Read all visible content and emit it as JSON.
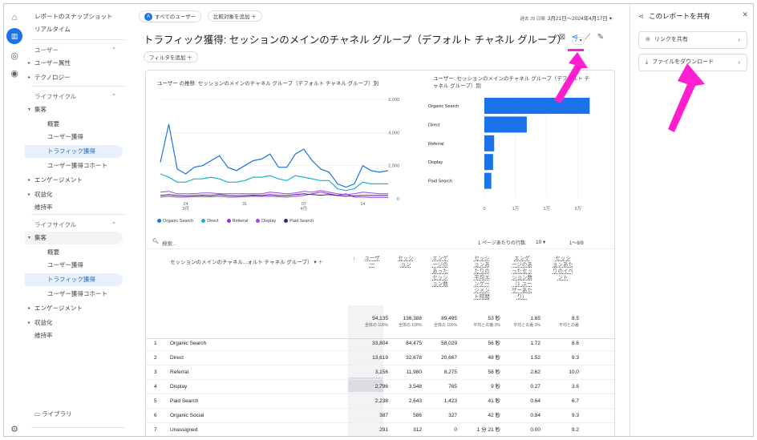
{
  "nav": {
    "items": [
      {
        "label": "レポートのスナップショット",
        "type": "top"
      },
      {
        "label": "リアルタイム",
        "type": "top"
      },
      {
        "label": "ユーザー",
        "type": "head"
      },
      {
        "label": "ユーザー属性",
        "type": "collapsed"
      },
      {
        "label": "テクノロジー",
        "type": "collapsed"
      },
      {
        "label": "ライフサイクル",
        "type": "head"
      },
      {
        "label": "集客",
        "type": "expanded"
      },
      {
        "label": "概要",
        "type": "sub"
      },
      {
        "label": "ユーザー獲得",
        "type": "sub"
      },
      {
        "label": "トラフィック獲得",
        "type": "sub-active"
      },
      {
        "label": "ユーザー獲得コホート",
        "type": "sub"
      },
      {
        "label": "エンゲージメント",
        "type": "collapsed"
      },
      {
        "label": "収益化",
        "type": "collapsed"
      },
      {
        "label": "維持率",
        "type": "plain"
      },
      {
        "label": "ライフサイクル",
        "type": "head"
      },
      {
        "label": "集客",
        "type": "expanded-grey"
      },
      {
        "label": "概要",
        "type": "sub"
      },
      {
        "label": "ユーザー獲得",
        "type": "sub"
      },
      {
        "label": "トラフィック獲得",
        "type": "sub-active"
      },
      {
        "label": "ユーザー獲得コホート",
        "type": "sub"
      },
      {
        "label": "エンゲージメント",
        "type": "collapsed"
      },
      {
        "label": "収益化",
        "type": "collapsed"
      },
      {
        "label": "維持率",
        "type": "plain"
      }
    ],
    "library": "ライブラリ"
  },
  "top": {
    "all_users": "すべてのユーザー",
    "add_comparison": "比較対象を追加",
    "date_prefix": "過去 28 日間",
    "date_range": "3月21日～2024年4月17日"
  },
  "report": {
    "title": "トラフィック獲得: セッションのメインのチャネル グループ（デフォルト チャネル グループ）",
    "add_filter": "フィルタを追加"
  },
  "line_chart": {
    "title": "ユーザー の推移: セッションのメインのチャネル グループ（デフォルト チャネル グループ）別",
    "y_ticks": [
      "6,000",
      "4,000",
      "2,000",
      "0"
    ],
    "x_ticks": [
      "24\n3月",
      "31",
      "07\n4月",
      "14"
    ],
    "legend": [
      "Organic Search",
      "Direct",
      "Referral",
      "Display",
      "Paid Search"
    ]
  },
  "bar_chart": {
    "title": "ユーザー: セッションのメインのチャネル グループ（デフォルト チャネル グループ）別",
    "x_ticks": [
      "0",
      "1万",
      "2万",
      "3万"
    ]
  },
  "chart_data": [
    {
      "type": "line",
      "title": "ユーザー の推移: セッションのメインのチャネル グループ（デフォルト チャネル グループ）別",
      "ylim": [
        0,
        6000
      ],
      "x": [
        1,
        2,
        3,
        4,
        5,
        6,
        7,
        8,
        9,
        10,
        11,
        12,
        13,
        14,
        15,
        16,
        17,
        18,
        19,
        20,
        21,
        22,
        23,
        24,
        25,
        26,
        27,
        28
      ],
      "series": [
        {
          "name": "Organic Search",
          "color": "#1a73e8",
          "values": [
            2200,
            4500,
            1800,
            1500,
            1900,
            2000,
            2300,
            2600,
            1900,
            1700,
            2000,
            2300,
            2400,
            2700,
            1900,
            1900,
            2700,
            3000,
            2300,
            1800,
            1600,
            900,
            700,
            900,
            2000,
            1700,
            1600,
            1700
          ]
        },
        {
          "name": "Direct",
          "color": "#12b5cb",
          "values": [
            1500,
            1300,
            1000,
            1000,
            1200,
            1200,
            1300,
            1200,
            1000,
            1000,
            1100,
            1300,
            1300,
            1400,
            1200,
            1100,
            1400,
            1300,
            1200,
            1100,
            1100,
            600,
            500,
            600,
            1000,
            900,
            900,
            900
          ]
        },
        {
          "name": "Referral",
          "color": "#9334e6",
          "values": [
            100,
            150,
            100,
            100,
            120,
            130,
            120,
            150,
            100,
            100,
            120,
            150,
            140,
            160,
            120,
            100,
            150,
            200,
            300,
            400,
            300,
            200,
            300,
            100,
            100,
            80,
            80,
            80
          ]
        },
        {
          "name": "Display",
          "color": "#a142f4",
          "values": [
            400,
            450,
            300,
            300,
            300,
            350,
            350,
            300,
            300,
            300,
            300,
            300,
            300,
            400,
            350,
            300,
            350,
            450,
            400,
            500,
            400,
            300,
            250,
            300,
            400,
            350,
            300,
            300
          ]
        },
        {
          "name": "Paid Search",
          "color": "#4a148c",
          "values": [
            200,
            250,
            200,
            180,
            200,
            220,
            200,
            250,
            200,
            180,
            200,
            220,
            200,
            250,
            200,
            200,
            250,
            300,
            250,
            220,
            250,
            200,
            150,
            180,
            200,
            200,
            200,
            200
          ]
        }
      ]
    },
    {
      "type": "bar",
      "title": "ユーザー: セッションのメインのチャネル グループ（デフォルト チャネル グループ）別",
      "categories": [
        "Organic Search",
        "Direct",
        "Referral",
        "Display",
        "Paid Search"
      ],
      "values": [
        33804,
        13619,
        3156,
        2796,
        2238
      ],
      "xlim": [
        0,
        35000
      ],
      "color": "#1a73e8"
    }
  ],
  "table": {
    "search_placeholder": "検索...",
    "rows_per_page_label": "1 ページあたりの行数:",
    "rows_per_page": "10",
    "pagination": "1～8/8",
    "dim_header": "セッションのメインのチャネル...ォルト チャネル グループ）",
    "columns": [
      "ユーザー",
      "セッション",
      "エンゲージのあったセッション数",
      "セッションあたりの平均エンゲージメント時間",
      "エンゲージのあったセッション数（1 ユーザーあたり）",
      "セッションあたりのイベント"
    ],
    "totals": [
      {
        "value": "54,135",
        "sub": "全体の 100%"
      },
      {
        "value": "136,388",
        "sub": "全体の 100%"
      },
      {
        "value": "89,495",
        "sub": "全体の 100%"
      },
      {
        "value": "53 秒",
        "sub": "平均との差 0%"
      },
      {
        "value": "1.65",
        "sub": "平均との差 0%"
      },
      {
        "value": "8.5",
        "sub": "平均との差"
      }
    ],
    "rows": [
      {
        "n": "1",
        "name": "Organic Search",
        "c": [
          "33,804",
          "84,475",
          "58,029",
          "56 秒",
          "1.72",
          "8.6"
        ]
      },
      {
        "n": "2",
        "name": "Direct",
        "c": [
          "13,619",
          "32,678",
          "20,667",
          "48 秒",
          "1.52",
          "8.3"
        ]
      },
      {
        "n": "3",
        "name": "Referral",
        "c": [
          "3,156",
          "11,980",
          "8,275",
          "58 秒",
          "2.62",
          "10.0"
        ]
      },
      {
        "n": "4",
        "name": "Display",
        "c": [
          "2,796",
          "3,548",
          "765",
          "9 秒",
          "0.27",
          "3.6"
        ]
      },
      {
        "n": "5",
        "name": "Paid Search",
        "c": [
          "2,238",
          "2,643",
          "1,423",
          "41 秒",
          "0.64",
          "6.7"
        ]
      },
      {
        "n": "6",
        "name": "Organic Social",
        "c": [
          "387",
          "586",
          "327",
          "42 秒",
          "0.84",
          "9.3"
        ]
      },
      {
        "n": "7",
        "name": "Unassigned",
        "c": [
          "291",
          "312",
          "0",
          "1 分 21 秒",
          "0.00",
          "9.2"
        ]
      }
    ]
  },
  "share_panel": {
    "title": "このレポートを共有",
    "share_link": "リンクを共有",
    "download": "ファイルをダウンロード"
  },
  "colors": {
    "accent": "#1a73e8",
    "annotation": "#ff1fd0"
  }
}
